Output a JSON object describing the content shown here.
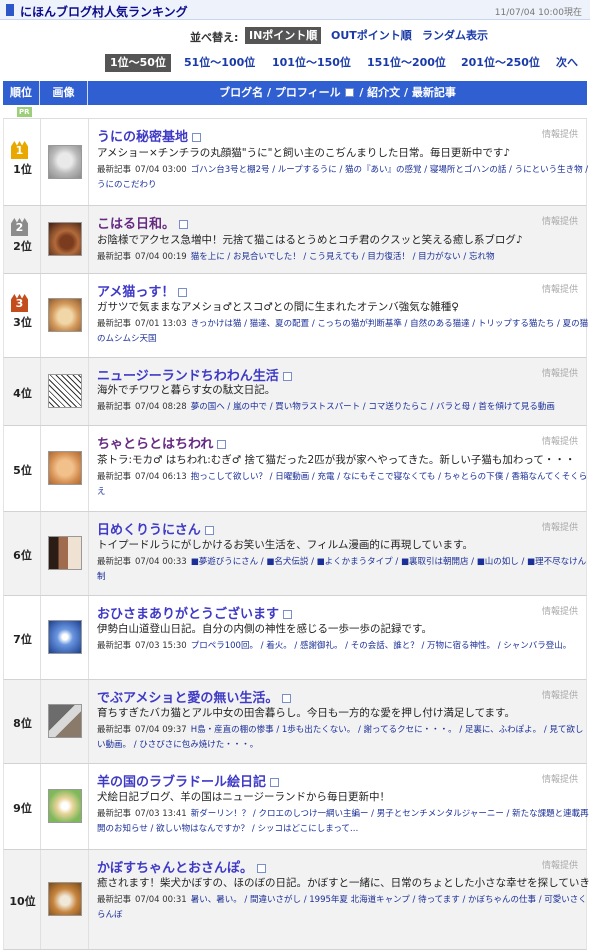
{
  "header": {
    "title": "にほんブログ村人気ランキング",
    "updated": "11/07/04 10:00現在"
  },
  "sort": {
    "label": "並べ替え:",
    "in_points": "INポイント順",
    "out_points": "OUTポイント順",
    "random": "ランダム表示"
  },
  "pager": {
    "p1": "1位〜50位",
    "p2": "51位〜100位",
    "p3": "101位〜150位",
    "p4": "151位〜200位",
    "p5": "201位〜250位",
    "next": "次へ"
  },
  "table_header": {
    "rank": "順位",
    "image": "画像",
    "blog_cols_a": "ブログ名 / プロフィール",
    "blog_cols_b": "/ 紹介文 / 最新記事"
  },
  "pr_badge": "PR",
  "labels": {
    "info": "情報提供",
    "latest": "最新記事"
  },
  "entries": [
    {
      "rank": "1位",
      "crown": "1",
      "title": "うにの秘密基地",
      "desc": "アメショー×チンチラの丸顔猫\"うに\"と飼い主のこぢんまりした日常。毎日更新中です♪",
      "date": "07/04 03:00",
      "posts": "ゴハン台3号と棚2号 / ループするうに / 猫の『あい』の感覚 / 寝場所とゴハンの話 / うにという生き物 / うにのこだわり"
    },
    {
      "rank": "2位",
      "crown": "2",
      "title": "こはる日和。",
      "desc": "お陰様でアクセス急増中！元捨て猫こはるとうめとコチ君のクスッと笑える癒し系ブログ♪",
      "date": "07/04 00:19",
      "posts": "猫を上に / お見合いでした！ / こう見えても / 目力復活！ / 目力がない / 忘れ物"
    },
    {
      "rank": "3位",
      "crown": "3",
      "title": "アメ猫っす！",
      "desc": "ガサツで気ままなアメショ♂とスコ♂との間に生まれたオテンバ強気な雑種♀",
      "date": "07/01 13:03",
      "posts": "きっかけは猫 / 猫達、夏の配置 / こっちの猫が判断基準 / 自然のある猫達 / トリップする猫たち / 夏の猫のムシムシ天国"
    },
    {
      "rank": "4位",
      "crown": "",
      "title": "ニュージーランドちわわん生活",
      "desc": "海外でチワワと暮らす女の駄文日記。",
      "date": "07/04 08:28",
      "posts": "夢の国へ / 嵐の中で / 買い物ラストスパート / コマ送りたらこ / バラと母 / 首を傾けて見る動画"
    },
    {
      "rank": "5位",
      "crown": "",
      "title": "ちゃとらとはちわれ",
      "desc": "茶トラ:モカ♂ はちわれ:むぎ♂ 捨て猫だった2匹が我が家へやってきた。新しい子猫も加わって・・・",
      "date": "07/04 06:13",
      "posts": "抱っこして欲しい？ / 日曜動画 / 充電 / なにもそこで寝なくても / ちゃとらの下僕 / 香箱なんてくそくらえ"
    },
    {
      "rank": "6位",
      "crown": "",
      "title": "日めくりうにさん",
      "desc": "トイプードルうにがしかけるお笑い生活を、フィルム漫画的に再現しています。",
      "date": "07/04 00:33",
      "posts": "■夢遊びうにさん / ■名犬伝説 / ■よくかまうタイプ / ■裏取引は朝開店 / ■山の如し / ■理不尽なけん制"
    },
    {
      "rank": "7位",
      "crown": "",
      "title": "おひさまありがとうございます",
      "desc": "伊勢白山道登山日記。自分の内側の神性を感じる一歩一歩の記録です。",
      "date": "07/03 15:30",
      "posts": "プロペラ100回。 / 着火。 / 感謝御礼。 / その会話、誰と？ / 万物に宿る神性。 / シャンバラ登山。"
    },
    {
      "rank": "8位",
      "crown": "",
      "title": "でぶアメショと愛の無い生活。",
      "desc": "育ちすぎたバカ猫とアル中女の田舎暮らし。今日も一方的な愛を押し付け満足してます。",
      "date": "07/04 09:37",
      "posts": "H島・産直の棚の惨事 / 1歩も出たくない。 / 謝ってるクセに・・・。 / 足裏に、ふわぽよ。 / 見て欲しい動画。 / ひさびさに包み焼けた・・・。"
    },
    {
      "rank": "9位",
      "crown": "",
      "title": "羊の国のラブラドール絵日記",
      "desc": "犬絵日記ブログ、羊の国はニュージーランドから毎日更新中！",
      "date": "07/03 13:41",
      "posts": "新ダーリン！？ / クロエのしつけ一網い主編ー / 男子とセンチメンタルジャーニー / 新たな課題と連載再開のお知らせ / 欲しい物はなんですか？ / シッコはどこにしまって…"
    },
    {
      "rank": "10位",
      "crown": "",
      "title": "かぼすちゃんとおさんぽ。",
      "desc": "癒されます！柴犬かぼすの、ほのぼの日記。かぼすと一緒に、日常のちょとした小さな幸せを探していきます。",
      "date": "07/04 00:31",
      "posts": "暑い、暑い。 / 間違いさがし / 1995年夏 北海道キャンプ / 待ってます / かぼちゃんの仕事 / 可愛いさくらんぼ"
    }
  ]
}
